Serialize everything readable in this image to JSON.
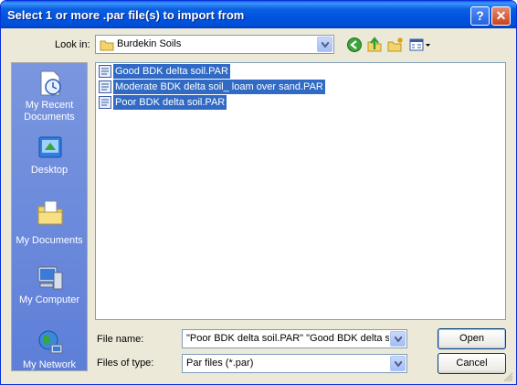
{
  "window": {
    "title": "Select 1 or more .par file(s) to import from"
  },
  "title_buttons": {
    "help": "?",
    "close": "✕"
  },
  "look_in": {
    "label": "Look in:",
    "value": "Burdekin Soils"
  },
  "places": [
    {
      "label": "My Recent Documents",
      "icon": "recent-documents-icon"
    },
    {
      "label": "Desktop",
      "icon": "desktop-icon"
    },
    {
      "label": "My Documents",
      "icon": "my-documents-icon"
    },
    {
      "label": "My Computer",
      "icon": "my-computer-icon"
    },
    {
      "label": "My Network",
      "icon": "my-network-icon"
    }
  ],
  "files": [
    {
      "name": "Good BDK delta soil.PAR",
      "selected": true
    },
    {
      "name": "Moderate BDK delta soil_ loam over sand.PAR",
      "selected": true
    },
    {
      "name": "Poor BDK delta soil.PAR",
      "selected": true
    }
  ],
  "file_name": {
    "label": "File name:",
    "value": "\"Poor BDK delta soil.PAR\" \"Good BDK delta s"
  },
  "files_of_type": {
    "label": "Files of type:",
    "value": "Par files (*.par)"
  },
  "buttons": {
    "open": "Open",
    "cancel": "Cancel"
  },
  "colors": {
    "title_bar": "#0053e1",
    "selection": "#316ac5",
    "places_bar": "#6b8ada",
    "dialog_face": "#ece9d8"
  }
}
